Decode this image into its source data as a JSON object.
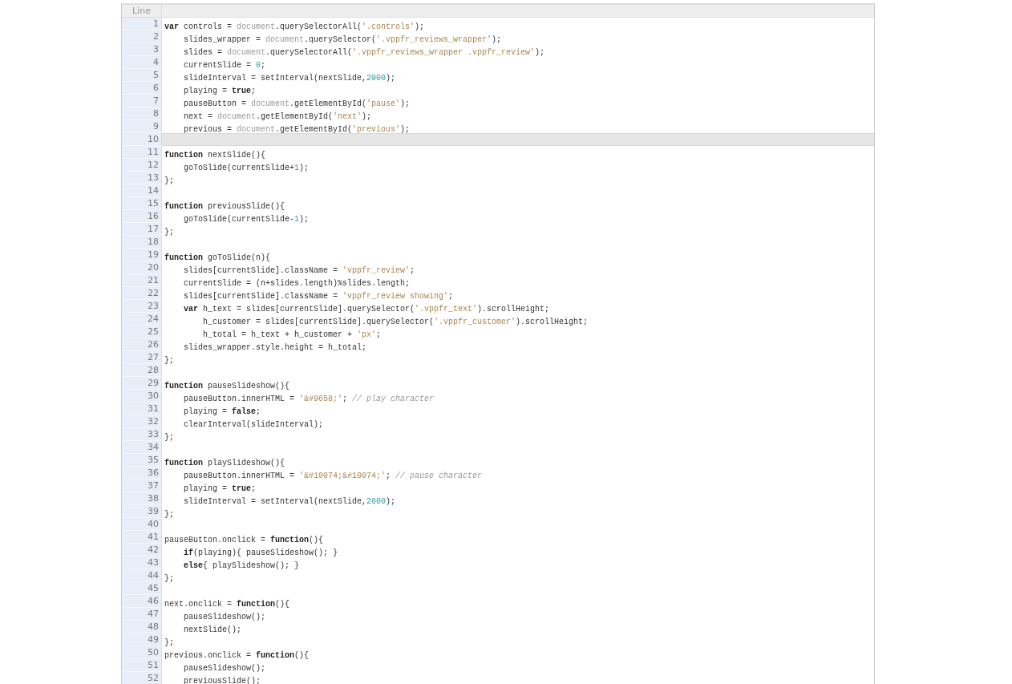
{
  "gutter_header": "Line",
  "lines": [
    {
      "number": "1",
      "highlighted": false,
      "tokens": [
        {
          "kind": "keyword",
          "text": "var"
        },
        {
          "kind": "plain",
          "text": " controls = "
        },
        {
          "kind": "builtin",
          "text": "document"
        },
        {
          "kind": "plain",
          "text": ".querySelectorAll("
        },
        {
          "kind": "string",
          "text": "'.controls'"
        },
        {
          "kind": "plain",
          "text": ");"
        }
      ]
    },
    {
      "number": "2",
      "highlighted": false,
      "tokens": [
        {
          "kind": "plain",
          "text": "    slides_wrapper = "
        },
        {
          "kind": "builtin",
          "text": "document"
        },
        {
          "kind": "plain",
          "text": ".querySelector("
        },
        {
          "kind": "string",
          "text": "'.vppfr_reviews_wrapper'"
        },
        {
          "kind": "plain",
          "text": ");"
        }
      ]
    },
    {
      "number": "3",
      "highlighted": false,
      "tokens": [
        {
          "kind": "plain",
          "text": "    slides = "
        },
        {
          "kind": "builtin",
          "text": "document"
        },
        {
          "kind": "plain",
          "text": ".querySelectorAll("
        },
        {
          "kind": "string",
          "text": "'.vppfr_reviews_wrapper .vppfr_review'"
        },
        {
          "kind": "plain",
          "text": ");"
        }
      ]
    },
    {
      "number": "4",
      "highlighted": false,
      "tokens": [
        {
          "kind": "plain",
          "text": "    currentSlide = "
        },
        {
          "kind": "number",
          "text": "0"
        },
        {
          "kind": "plain",
          "text": ";"
        }
      ]
    },
    {
      "number": "5",
      "highlighted": false,
      "tokens": [
        {
          "kind": "plain",
          "text": "    slideInterval = setInterval(nextSlide,"
        },
        {
          "kind": "number",
          "text": "2000"
        },
        {
          "kind": "plain",
          "text": ");"
        }
      ]
    },
    {
      "number": "6",
      "highlighted": false,
      "tokens": [
        {
          "kind": "plain",
          "text": "    playing = "
        },
        {
          "kind": "keyword",
          "text": "true"
        },
        {
          "kind": "plain",
          "text": ";"
        }
      ]
    },
    {
      "number": "7",
      "highlighted": false,
      "tokens": [
        {
          "kind": "plain",
          "text": "    pauseButton = "
        },
        {
          "kind": "builtin",
          "text": "document"
        },
        {
          "kind": "plain",
          "text": ".getElementById("
        },
        {
          "kind": "string",
          "text": "'pause'"
        },
        {
          "kind": "plain",
          "text": ");"
        }
      ]
    },
    {
      "number": "8",
      "highlighted": false,
      "tokens": [
        {
          "kind": "plain",
          "text": "    next = "
        },
        {
          "kind": "builtin",
          "text": "document"
        },
        {
          "kind": "plain",
          "text": ".getElementById("
        },
        {
          "kind": "string",
          "text": "'next'"
        },
        {
          "kind": "plain",
          "text": ");"
        }
      ]
    },
    {
      "number": "9",
      "highlighted": false,
      "tokens": [
        {
          "kind": "plain",
          "text": "    previous = "
        },
        {
          "kind": "builtin",
          "text": "document"
        },
        {
          "kind": "plain",
          "text": ".getElementById("
        },
        {
          "kind": "string",
          "text": "'previous'"
        },
        {
          "kind": "plain",
          "text": ");"
        }
      ]
    },
    {
      "number": "10",
      "highlighted": true
    },
    {
      "number": "11",
      "highlighted": false,
      "tokens": [
        {
          "kind": "keyword",
          "text": "function"
        },
        {
          "kind": "plain",
          "text": " nextSlide(){"
        }
      ]
    },
    {
      "number": "12",
      "highlighted": false,
      "tokens": [
        {
          "kind": "plain",
          "text": "    goToSlide(currentSlide+"
        },
        {
          "kind": "number",
          "text": "1"
        },
        {
          "kind": "plain",
          "text": ");"
        }
      ]
    },
    {
      "number": "13",
      "highlighted": false,
      "tokens": [
        {
          "kind": "plain",
          "text": "};"
        }
      ]
    },
    {
      "number": "14",
      "highlighted": false
    },
    {
      "number": "15",
      "highlighted": false,
      "tokens": [
        {
          "kind": "keyword",
          "text": "function"
        },
        {
          "kind": "plain",
          "text": " previousSlide(){"
        }
      ]
    },
    {
      "number": "16",
      "highlighted": false,
      "tokens": [
        {
          "kind": "plain",
          "text": "    goToSlide(currentSlide-"
        },
        {
          "kind": "number",
          "text": "1"
        },
        {
          "kind": "plain",
          "text": ");"
        }
      ]
    },
    {
      "number": "17",
      "highlighted": false,
      "tokens": [
        {
          "kind": "plain",
          "text": "};"
        }
      ]
    },
    {
      "number": "18",
      "highlighted": false
    },
    {
      "number": "19",
      "highlighted": false,
      "tokens": [
        {
          "kind": "keyword",
          "text": "function"
        },
        {
          "kind": "plain",
          "text": " goToSlide(n){"
        }
      ]
    },
    {
      "number": "20",
      "highlighted": false,
      "tokens": [
        {
          "kind": "plain",
          "text": "    slides[currentSlide].className = "
        },
        {
          "kind": "string",
          "text": "'vppfr_review'"
        },
        {
          "kind": "plain",
          "text": ";"
        }
      ]
    },
    {
      "number": "21",
      "highlighted": false,
      "tokens": [
        {
          "kind": "plain",
          "text": "    currentSlide = (n+slides.length)%slides.length;"
        }
      ]
    },
    {
      "number": "22",
      "highlighted": false,
      "tokens": [
        {
          "kind": "plain",
          "text": "    slides[currentSlide].className = "
        },
        {
          "kind": "string",
          "text": "'vppfr_review showing'"
        },
        {
          "kind": "plain",
          "text": ";"
        }
      ]
    },
    {
      "number": "23",
      "highlighted": false,
      "tokens": [
        {
          "kind": "keyword",
          "text": "    var"
        },
        {
          "kind": "plain",
          "text": " h_text = slides[currentSlide].querySelector("
        },
        {
          "kind": "string",
          "text": "'.vppfr_text'"
        },
        {
          "kind": "plain",
          "text": ").scrollHeight;"
        }
      ]
    },
    {
      "number": "24",
      "highlighted": false,
      "tokens": [
        {
          "kind": "plain",
          "text": "        h_customer = slides[currentSlide].querySelector("
        },
        {
          "kind": "string",
          "text": "'.vppfr_customer'"
        },
        {
          "kind": "plain",
          "text": ").scrollHeight;"
        }
      ]
    },
    {
      "number": "25",
      "highlighted": false,
      "tokens": [
        {
          "kind": "plain",
          "text": "        h_total = h_text + h_customer + "
        },
        {
          "kind": "string",
          "text": "'px'"
        },
        {
          "kind": "plain",
          "text": ";"
        }
      ]
    },
    {
      "number": "26",
      "highlighted": false,
      "tokens": [
        {
          "kind": "plain",
          "text": "    slides_wrapper.style.height = h_total;"
        }
      ]
    },
    {
      "number": "27",
      "highlighted": false,
      "tokens": [
        {
          "kind": "plain",
          "text": "};"
        }
      ]
    },
    {
      "number": "28",
      "highlighted": false
    },
    {
      "number": "29",
      "highlighted": false,
      "tokens": [
        {
          "kind": "keyword",
          "text": "function"
        },
        {
          "kind": "plain",
          "text": " pauseSlideshow(){"
        }
      ]
    },
    {
      "number": "30",
      "highlighted": false,
      "tokens": [
        {
          "kind": "plain",
          "text": "    pauseButton.innerHTML = "
        },
        {
          "kind": "string",
          "text": "'&#9658;'"
        },
        {
          "kind": "plain",
          "text": "; "
        },
        {
          "kind": "comment",
          "text": "// play character"
        }
      ]
    },
    {
      "number": "31",
      "highlighted": false,
      "tokens": [
        {
          "kind": "plain",
          "text": "    playing = "
        },
        {
          "kind": "keyword",
          "text": "false"
        },
        {
          "kind": "plain",
          "text": ";"
        }
      ]
    },
    {
      "number": "32",
      "highlighted": false,
      "tokens": [
        {
          "kind": "plain",
          "text": "    clearInterval(slideInterval);"
        }
      ]
    },
    {
      "number": "33",
      "highlighted": false,
      "tokens": [
        {
          "kind": "plain",
          "text": "};"
        }
      ]
    },
    {
      "number": "34",
      "highlighted": false
    },
    {
      "number": "35",
      "highlighted": false,
      "tokens": [
        {
          "kind": "keyword",
          "text": "function"
        },
        {
          "kind": "plain",
          "text": " playSlideshow(){"
        }
      ]
    },
    {
      "number": "36",
      "highlighted": false,
      "tokens": [
        {
          "kind": "plain",
          "text": "    pauseButton.innerHTML = "
        },
        {
          "kind": "string",
          "text": "'&#10074;&#10074;'"
        },
        {
          "kind": "plain",
          "text": "; "
        },
        {
          "kind": "comment",
          "text": "// pause character"
        }
      ]
    },
    {
      "number": "37",
      "highlighted": false,
      "tokens": [
        {
          "kind": "plain",
          "text": "    playing = "
        },
        {
          "kind": "keyword",
          "text": "true"
        },
        {
          "kind": "plain",
          "text": ";"
        }
      ]
    },
    {
      "number": "38",
      "highlighted": false,
      "tokens": [
        {
          "kind": "plain",
          "text": "    slideInterval = setInterval(nextSlide,"
        },
        {
          "kind": "number",
          "text": "2000"
        },
        {
          "kind": "plain",
          "text": ");"
        }
      ]
    },
    {
      "number": "39",
      "highlighted": false,
      "tokens": [
        {
          "kind": "plain",
          "text": "};"
        }
      ]
    },
    {
      "number": "40",
      "highlighted": false
    },
    {
      "number": "41",
      "highlighted": false,
      "tokens": [
        {
          "kind": "plain",
          "text": "pauseButton.onclick = "
        },
        {
          "kind": "keyword",
          "text": "function"
        },
        {
          "kind": "plain",
          "text": "(){"
        }
      ]
    },
    {
      "number": "42",
      "highlighted": false,
      "tokens": [
        {
          "kind": "keyword",
          "text": "    if"
        },
        {
          "kind": "plain",
          "text": "(playing){ pauseSlideshow(); }"
        }
      ]
    },
    {
      "number": "43",
      "highlighted": false,
      "tokens": [
        {
          "kind": "keyword",
          "text": "    else"
        },
        {
          "kind": "plain",
          "text": "{ playSlideshow(); }"
        }
      ]
    },
    {
      "number": "44",
      "highlighted": false,
      "tokens": [
        {
          "kind": "plain",
          "text": "};"
        }
      ]
    },
    {
      "number": "45",
      "highlighted": false
    },
    {
      "number": "46",
      "highlighted": false,
      "tokens": [
        {
          "kind": "plain",
          "text": "next.onclick = "
        },
        {
          "kind": "keyword",
          "text": "function"
        },
        {
          "kind": "plain",
          "text": "(){"
        }
      ]
    },
    {
      "number": "47",
      "highlighted": false,
      "tokens": [
        {
          "kind": "plain",
          "text": "    pauseSlideshow();"
        }
      ]
    },
    {
      "number": "48",
      "highlighted": false,
      "tokens": [
        {
          "kind": "plain",
          "text": "    nextSlide();"
        }
      ]
    },
    {
      "number": "49",
      "highlighted": false,
      "tokens": [
        {
          "kind": "plain",
          "text": "};"
        }
      ]
    },
    {
      "number": "50",
      "highlighted": false,
      "tokens": [
        {
          "kind": "plain",
          "text": "previous.onclick = "
        },
        {
          "kind": "keyword",
          "text": "function"
        },
        {
          "kind": "plain",
          "text": "(){"
        }
      ]
    },
    {
      "number": "51",
      "highlighted": false,
      "tokens": [
        {
          "kind": "plain",
          "text": "    pauseSlideshow();"
        }
      ]
    },
    {
      "number": "52",
      "highlighted": false,
      "tokens": [
        {
          "kind": "plain",
          "text": "    previousSlide();"
        }
      ]
    }
  ]
}
